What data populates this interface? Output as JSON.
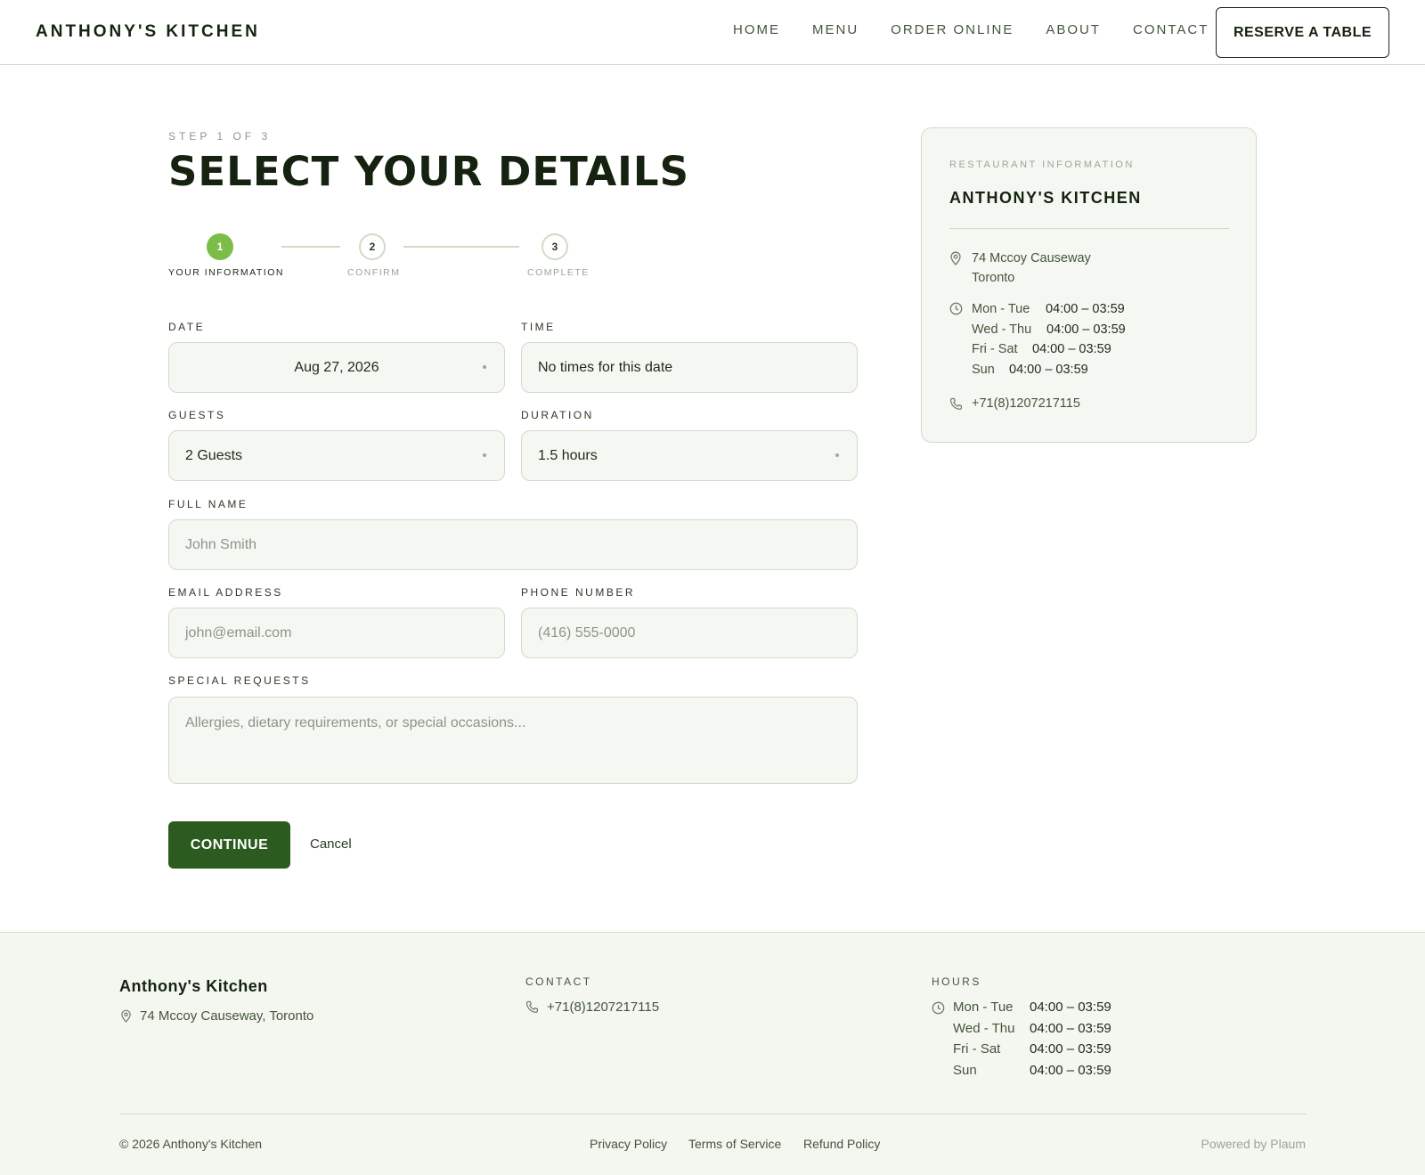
{
  "header": {
    "brand": "ANTHONY'S KITCHEN",
    "nav": [
      "HOME",
      "MENU",
      "ORDER ONLINE",
      "ABOUT",
      "CONTACT"
    ],
    "reserve_label": "RESERVE A TABLE"
  },
  "form": {
    "step_label": "STEP 1 OF 3",
    "title": "SELECT YOUR DETAILS",
    "steps": [
      {
        "number": "1",
        "label": "YOUR INFORMATION",
        "state": "active"
      },
      {
        "number": "2",
        "label": "CONFIRM",
        "state": "inactive"
      },
      {
        "number": "3",
        "label": "COMPLETE",
        "state": "inactive"
      }
    ],
    "date": {
      "label": "DATE",
      "value": "Aug 27, 2026"
    },
    "time": {
      "label": "TIME",
      "value": "No times for this date"
    },
    "guests": {
      "label": "GUESTS",
      "value": "2 Guests"
    },
    "duration": {
      "label": "DURATION",
      "value": "1.5 hours"
    },
    "full_name": {
      "label": "FULL NAME",
      "placeholder": "John Smith"
    },
    "email": {
      "label": "EMAIL ADDRESS",
      "placeholder": "john@email.com"
    },
    "phone": {
      "label": "PHONE NUMBER",
      "placeholder": "(416) 555-0000"
    },
    "special": {
      "label": "SPECIAL REQUESTS",
      "placeholder": "Allergies, dietary requirements, or special occasions..."
    },
    "continue_label": "CONTINUE",
    "cancel_label": "Cancel"
  },
  "info": {
    "eyebrow": "RESTAURANT INFORMATION",
    "name": "ANTHONY'S KITCHEN",
    "address_line1": "74 Mccoy Causeway",
    "address_line2": "Toronto",
    "hours": [
      {
        "days": "Mon - Tue",
        "time": "04:00 – 03:59"
      },
      {
        "days": "Wed - Thu",
        "time": "04:00 – 03:59"
      },
      {
        "days": "Fri - Sat",
        "time": "04:00 – 03:59"
      },
      {
        "days": "Sun",
        "time": "04:00 – 03:59"
      }
    ],
    "phone": "+71(8)1207217115"
  },
  "footer": {
    "brand": "Anthony's Kitchen",
    "address": "74 Mccoy Causeway, Toronto",
    "contact_heading": "CONTACT",
    "phone": "+71(8)1207217115",
    "hours_heading": "HOURS",
    "hours": [
      {
        "days": "Mon - Tue",
        "time": "04:00 – 03:59"
      },
      {
        "days": "Wed - Thu",
        "time": "04:00 – 03:59"
      },
      {
        "days": "Fri - Sat",
        "time": "04:00 – 03:59"
      },
      {
        "days": "Sun",
        "time": "04:00 – 03:59"
      }
    ],
    "copyright": "© 2026 Anthony's Kitchen",
    "links": [
      "Privacy Policy",
      "Terms of Service",
      "Refund Policy"
    ],
    "powered": "Powered by Plaum"
  },
  "colors": {
    "accent_green": "#7cbd4a",
    "button_green": "#2b5b1e",
    "border": "#cfdcc6",
    "field_bg": "#f5f8f2"
  }
}
